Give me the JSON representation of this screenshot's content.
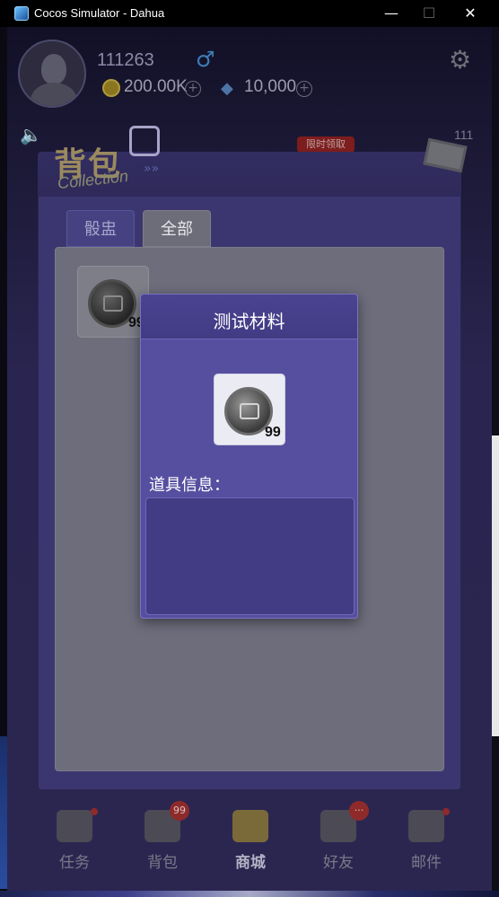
{
  "window": {
    "title": "Cocos Simulator - Dahua",
    "minimize": "—",
    "maximize": "☐",
    "close": "✕"
  },
  "hud": {
    "player_id": "111263",
    "gender_symbol": "♂",
    "coins": "200.00K",
    "diamonds": "10,000",
    "plus": "+",
    "settings_icon": "⚙",
    "speaker_icon": "🔈",
    "count": "111",
    "promo": "限时领取"
  },
  "backpack": {
    "title": "背包",
    "subtitle": "Collection",
    "arrows": "»»",
    "tabs": [
      {
        "label": "骰盅",
        "active": false
      },
      {
        "label": "全部",
        "active": true
      }
    ],
    "items": [
      {
        "icon": "dice-coin-icon",
        "quantity": "99"
      }
    ]
  },
  "popup": {
    "title": "测试材料",
    "item_quantity": "99",
    "info_label": "道具信息：",
    "info_text": ""
  },
  "nav": {
    "items": [
      {
        "label": "任务",
        "icon": "calendar-icon",
        "badge": ""
      },
      {
        "label": "背包",
        "icon": "backpack-icon",
        "badge": "99"
      },
      {
        "label": "商城",
        "icon": "shop-cart-icon",
        "badge": ""
      },
      {
        "label": "好友",
        "icon": "friends-icon",
        "badge": "..."
      },
      {
        "label": "邮件",
        "icon": "mail-icon",
        "badge": ""
      }
    ]
  },
  "colors": {
    "panel": "#3c3670",
    "popup": "#564fa0",
    "content": "#6d6d7c"
  }
}
